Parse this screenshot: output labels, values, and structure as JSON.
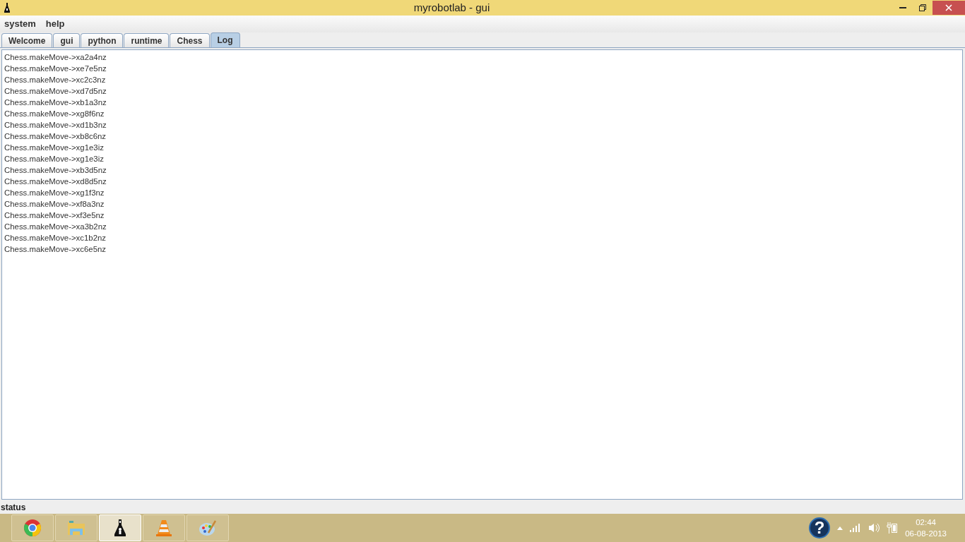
{
  "window": {
    "title": "myrobotlab - gui"
  },
  "menu": [
    "system",
    "help"
  ],
  "tabs": [
    {
      "label": "Welcome",
      "selected": false
    },
    {
      "label": "gui",
      "selected": false
    },
    {
      "label": "python",
      "selected": false
    },
    {
      "label": "runtime",
      "selected": false
    },
    {
      "label": "Chess",
      "selected": false
    },
    {
      "label": "Log",
      "selected": true
    }
  ],
  "log_lines": [
    "Chess.makeMove->xa2a4nz",
    "Chess.makeMove->xe7e5nz",
    "Chess.makeMove->xc2c3nz",
    "Chess.makeMove->xd7d5nz",
    "Chess.makeMove->xb1a3nz",
    "Chess.makeMove->xg8f6nz",
    "Chess.makeMove->xd1b3nz",
    "Chess.makeMove->xb8c6nz",
    "Chess.makeMove->xg1e3iz",
    "Chess.makeMove->xg1e3iz",
    "Chess.makeMove->xb3d5nz",
    "Chess.makeMove->xd8d5nz",
    "Chess.makeMove->xg1f3nz",
    "Chess.makeMove->xf8a3nz",
    "Chess.makeMove->xf3e5nz",
    "Chess.makeMove->xa3b2nz",
    "Chess.makeMove->xc1b2nz",
    "Chess.makeMove->xc6e5nz"
  ],
  "status_bar": {
    "text": "status"
  },
  "taskbar": {
    "apps": [
      {
        "kind": "browser",
        "selected": false
      },
      {
        "kind": "folder",
        "selected": false
      },
      {
        "kind": "flask",
        "selected": true
      },
      {
        "kind": "cone",
        "selected": false
      },
      {
        "kind": "palette",
        "selected": false
      }
    ],
    "help_glyph": "?",
    "time": "02:44",
    "date": "06-08-2013"
  }
}
